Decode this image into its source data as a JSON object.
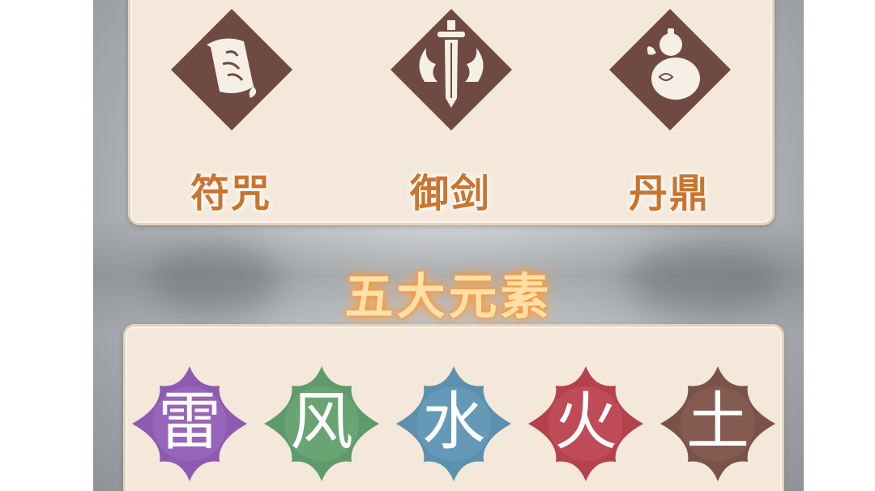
{
  "skills_section": {
    "items": [
      {
        "label": "符咒",
        "icon": "scroll-icon"
      },
      {
        "label": "御剑",
        "icon": "sword-icon"
      },
      {
        "label": "丹鼎",
        "icon": "gourd-icon"
      }
    ]
  },
  "elements_section": {
    "title": "五大元素",
    "items": [
      {
        "char": "雷",
        "color": "#8e5bb0"
      },
      {
        "char": "风",
        "color": "#5f9a6a"
      },
      {
        "char": "水",
        "color": "#5d8fae"
      },
      {
        "char": "火",
        "color": "#b4424b"
      },
      {
        "char": "土",
        "color": "#7a5248"
      }
    ]
  },
  "colors": {
    "diamond": "#6f4a43",
    "label": "#c9752f",
    "panel": "#f3e8da"
  }
}
